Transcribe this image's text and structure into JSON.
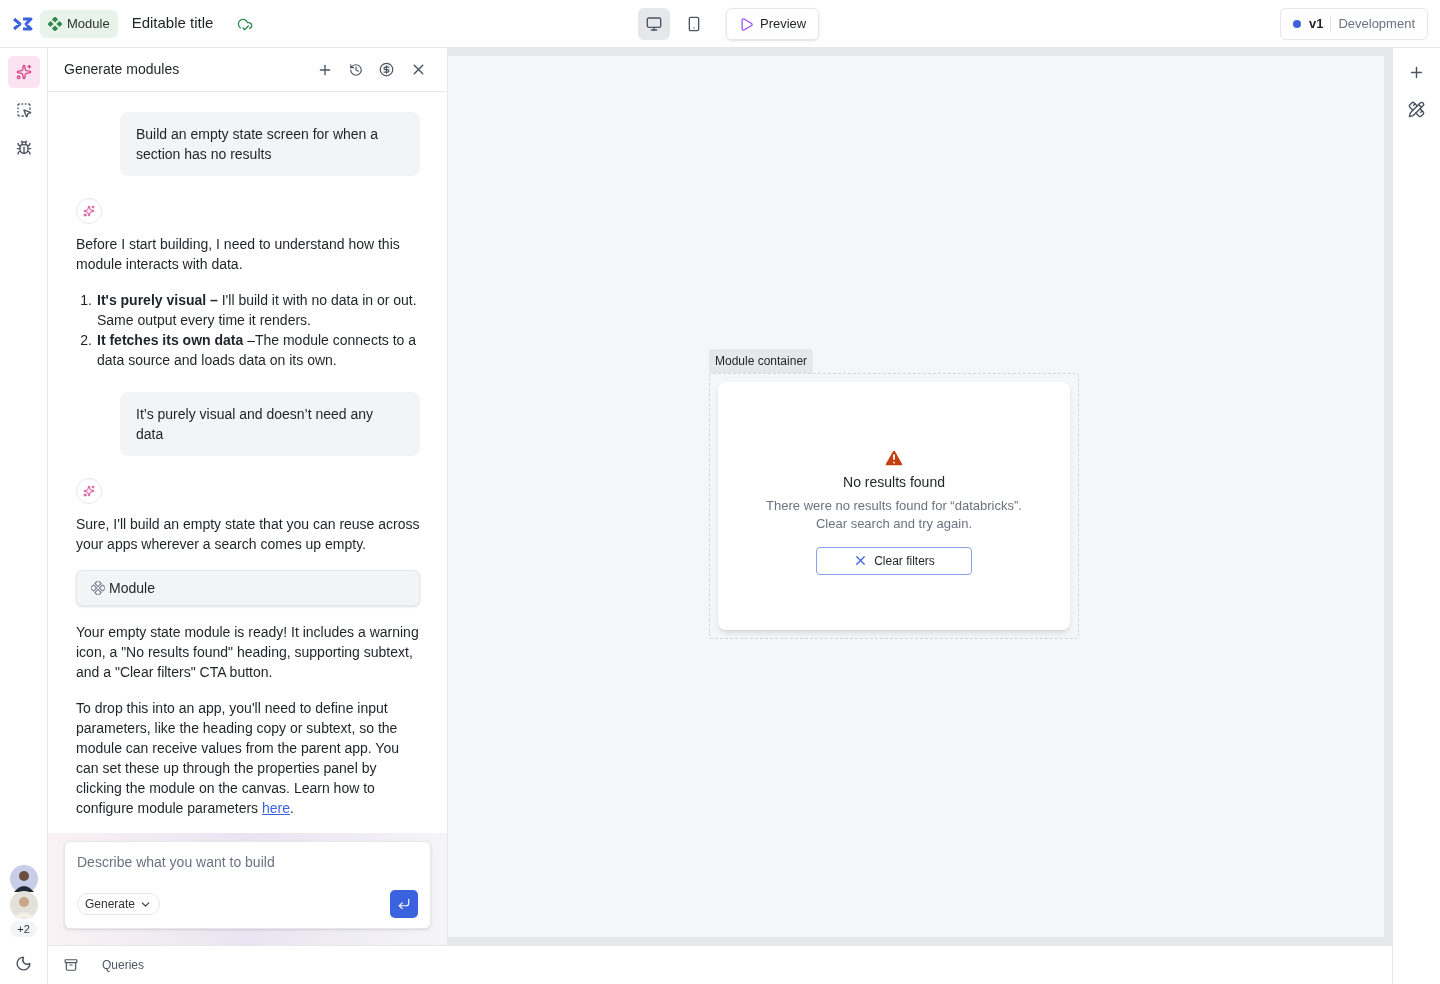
{
  "header": {
    "module_badge": "Module",
    "title": "Editable title",
    "devices": [
      {
        "kind": "desktop",
        "selected": true
      },
      {
        "kind": "mobile",
        "selected": false
      }
    ],
    "preview": "Preview",
    "version": {
      "label": "v1",
      "env": "Development",
      "color": "#3b63e0"
    }
  },
  "left_rail": {
    "tools": [
      {
        "kind": "sparkle",
        "selected": true
      },
      {
        "kind": "select",
        "selected": false
      },
      {
        "kind": "bug",
        "selected": false
      }
    ],
    "avatars_more": "+2"
  },
  "chat": {
    "title": "Generate modules",
    "messages": [
      {
        "kind": "user",
        "text": "Build an empty state screen for when a section has no results"
      },
      {
        "kind": "assistant",
        "blocks": [
          {
            "kind": "paragraph",
            "text": "Before I start building, I need to understand how this module interacts with data."
          },
          {
            "kind": "list",
            "items": [
              {
                "number": "1.",
                "text": "**It's purely visual –** I'll build it with no data in or out. Same output every time it renders."
              },
              {
                "number": "2.",
                "text": "**It fetches its own data** –The module connects to a data source and loads data on its own."
              }
            ]
          }
        ]
      },
      {
        "kind": "user",
        "text": "It’s purely visual and doesn’t need any data"
      },
      {
        "kind": "assistant",
        "blocks": [
          {
            "kind": "paragraph",
            "text": "Sure, I'll build an empty state that you can reuse across your apps wherever a search comes up empty."
          },
          {
            "kind": "module_chip",
            "label": "Module"
          },
          {
            "kind": "paragraph",
            "text": "Your empty state module is ready! It includes a warning icon, a \"No results found\" heading, supporting subtext, and a \"Clear filters\" CTA button."
          },
          {
            "kind": "paragraph",
            "text": "To drop this into an app, you'll need to define input parameters, like the heading copy or subtext, so the module can receive values from the parent app. You can set these up through the properties panel by clicking the module on the canvas. Learn how to configure module parameters ",
            "link": "here",
            "after": "."
          }
        ]
      }
    ],
    "input": {
      "placeholder": "Describe what you want to build",
      "mode": "Generate"
    }
  },
  "canvas": {
    "container_label": "Module container",
    "empty_state": {
      "heading": "No results found",
      "subtext": "There were no results found for “databricks”. Clear search and try again.",
      "button": "Clear filters"
    }
  },
  "bottom_bar": {
    "label": "Queries"
  }
}
